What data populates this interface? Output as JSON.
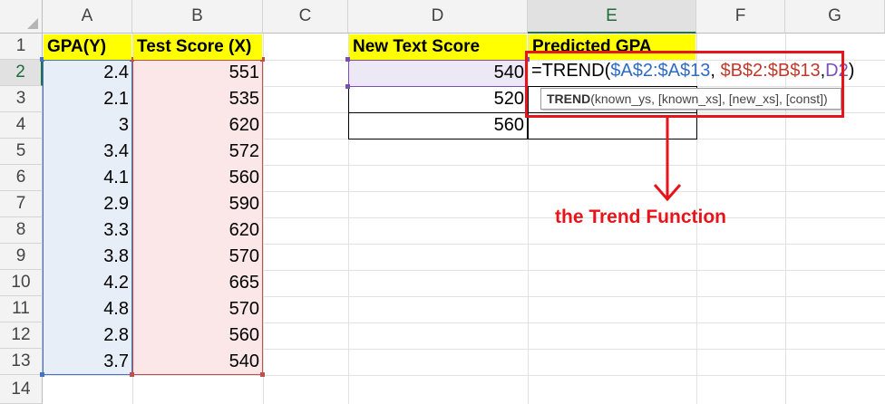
{
  "sheet": {
    "columns": [
      "A",
      "B",
      "C",
      "D",
      "E",
      "F",
      "G"
    ],
    "rows": [
      "1",
      "2",
      "3",
      "4",
      "5",
      "6",
      "7",
      "8",
      "9",
      "10",
      "11",
      "12",
      "13",
      "14"
    ]
  },
  "table_left": {
    "header_a": "GPA(Y)",
    "header_b": "Test Score (X)",
    "gpa": [
      "2.4",
      "2.1",
      "3",
      "3.4",
      "4.1",
      "2.9",
      "3.3",
      "3.8",
      "4.2",
      "4.8",
      "2.8",
      "3.7"
    ],
    "test_score": [
      "551",
      "535",
      "620",
      "572",
      "560",
      "590",
      "620",
      "570",
      "665",
      "570",
      "560",
      "540"
    ]
  },
  "table_right": {
    "header_d": "New Text Score",
    "header_e": "Predicted GPA",
    "new_scores": [
      "540",
      "520",
      "560"
    ]
  },
  "formula": {
    "part1": "=TREND(",
    "part2": "$A$2:$A$13",
    "part3": ", ",
    "part4": "$B$2:$B$13",
    "part5": ",",
    "part6": "D2",
    "part7": ")"
  },
  "tooltip": {
    "func": "TREND",
    "args": "(known_ys, [known_xs], [new_xs], [const])"
  },
  "annotation": "the Trend Function",
  "colors": {
    "accent_red": "#e8141b",
    "range_a": "#4472c4",
    "range_b": "#c0504d",
    "header_fill": "#ffff00"
  }
}
